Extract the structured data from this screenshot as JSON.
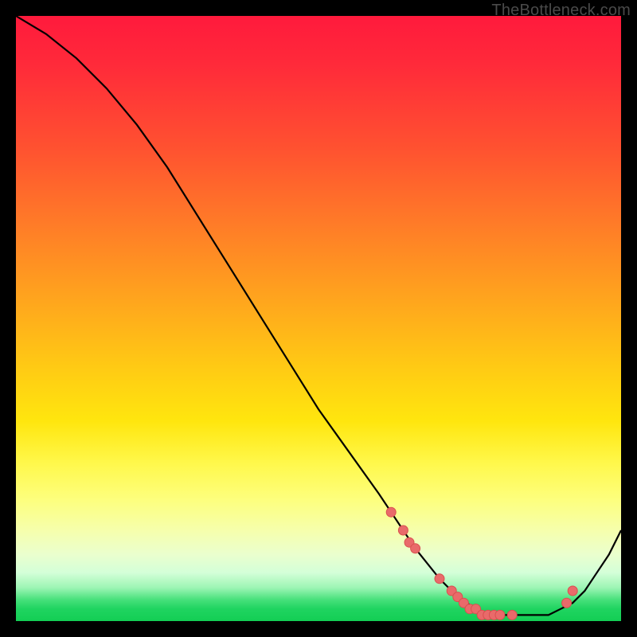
{
  "watermark": "TheBottleneck.com",
  "colors": {
    "frame": "#000000",
    "curve_stroke": "#000000",
    "marker_fill": "#e96a6a",
    "marker_stroke": "#d94f4f"
  },
  "chart_data": {
    "type": "line",
    "title": "",
    "xlabel": "",
    "ylabel": "",
    "xlim": [
      0,
      100
    ],
    "ylim": [
      0,
      100
    ],
    "grid": false,
    "legend": false,
    "series": [
      {
        "name": "bottleneck-curve",
        "x": [
          0,
          5,
          10,
          15,
          20,
          25,
          30,
          35,
          40,
          45,
          50,
          55,
          60,
          62,
          66,
          70,
          73,
          76,
          78,
          80,
          82,
          84,
          86,
          88,
          90,
          92,
          94,
          96,
          98,
          100
        ],
        "y": [
          100,
          97,
          93,
          88,
          82,
          75,
          67,
          59,
          51,
          43,
          35,
          28,
          21,
          18,
          12,
          7,
          4,
          2,
          1,
          1,
          1,
          1,
          1,
          1,
          2,
          3,
          5,
          8,
          11,
          15
        ]
      }
    ],
    "markers": {
      "name": "highlighted-points",
      "x": [
        62,
        64,
        65,
        66,
        70,
        72,
        73,
        74,
        75,
        76,
        77,
        78,
        79,
        80,
        82,
        91,
        92
      ],
      "y": [
        18,
        15,
        13,
        12,
        7,
        5,
        4,
        3,
        2,
        2,
        1,
        1,
        1,
        1,
        1,
        3,
        5
      ]
    },
    "background_gradient": {
      "orientation": "vertical",
      "stops": [
        {
          "pos": 0.0,
          "color": "#ff1a3c"
        },
        {
          "pos": 0.34,
          "color": "#ff7a28"
        },
        {
          "pos": 0.58,
          "color": "#ffca14"
        },
        {
          "pos": 0.8,
          "color": "#fdff7e"
        },
        {
          "pos": 0.92,
          "color": "#d4ffd8"
        },
        {
          "pos": 1.0,
          "color": "#13ce54"
        }
      ]
    }
  }
}
